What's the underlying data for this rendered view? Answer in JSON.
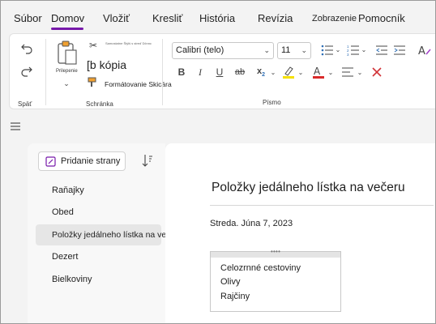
{
  "tabs": [
    {
      "label": "Súbor"
    },
    {
      "label": "Domov",
      "active": true
    },
    {
      "label": "Vložiť"
    },
    {
      "label": "Kresliť"
    },
    {
      "label": "História"
    },
    {
      "label": "Revízia"
    },
    {
      "label": "Zobrazenie"
    },
    {
      "label": "Pomocník"
    }
  ],
  "ribbon": {
    "undo_group_label": "Späť",
    "clipboard": {
      "paste_label": "Prilepenie",
      "cut_label": "Samostatne Štýlš s streď Dčnnc",
      "copy_label": "[b kópia",
      "format_painter_label": "Formátovanie Skicára",
      "group_label": "Schránka"
    },
    "font": {
      "font_name": "Calibri (telo)",
      "font_size": "11",
      "group_label": "Písmo",
      "bold": "B",
      "italic": "I",
      "underline": "U",
      "strike": "ab",
      "subscript": "x",
      "subscript_index": "2",
      "highlight_color": "#f5e000",
      "font_color": "#d92b2b"
    }
  },
  "pages_pane": {
    "add_page_label": "Pridanie strany",
    "items": [
      {
        "label": "Raňajky"
      },
      {
        "label": "Obed"
      },
      {
        "label": "Položky jedálneho lístka na večeru",
        "selected": true
      },
      {
        "label": "Dezert"
      },
      {
        "label": "Bielkoviny"
      }
    ]
  },
  "page": {
    "title": "Položky jedálneho lístka na večeru",
    "date": "Streda. Júna 7, 2023",
    "note_items": [
      "Celozrnné cestoviny",
      "Olivy",
      "Rajčiny"
    ]
  },
  "colors": {
    "accent": "#7719aa",
    "delete_x": "#d13438",
    "icon_blue": "#2f6fb5"
  }
}
